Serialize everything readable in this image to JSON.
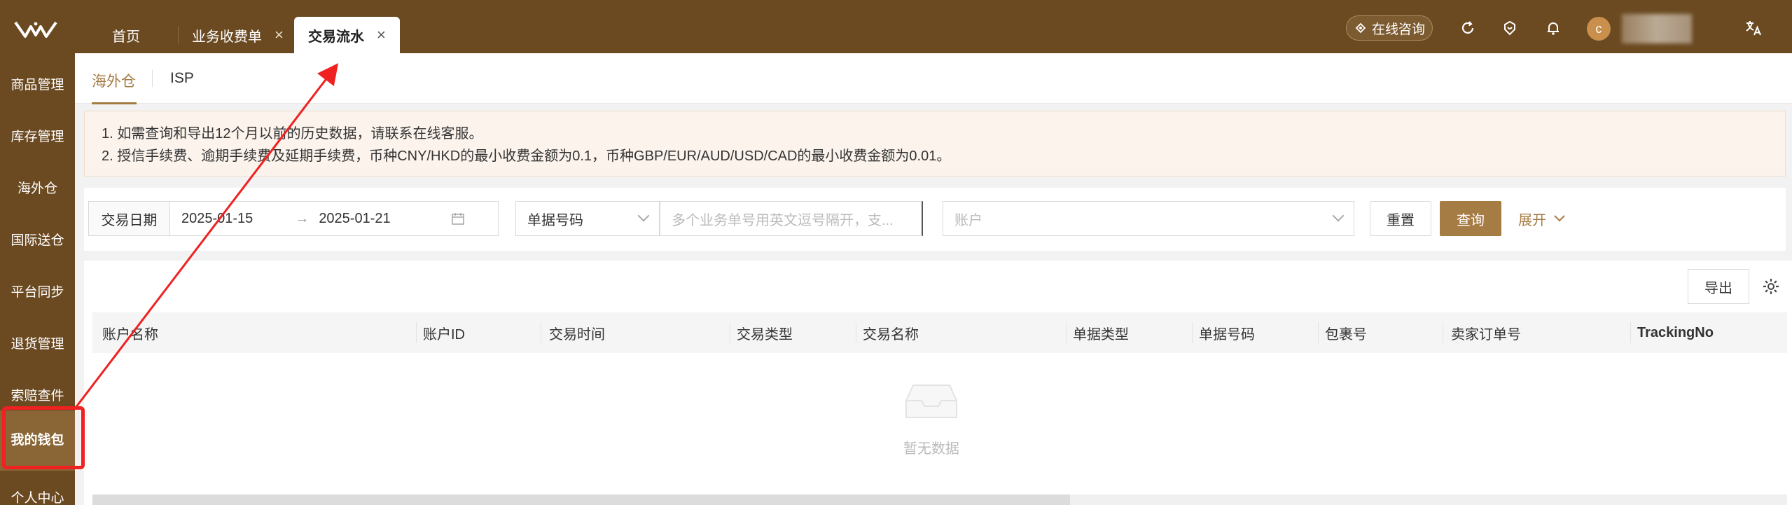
{
  "topbar": {
    "tabs": [
      {
        "label": "首页",
        "closable": false
      },
      {
        "label": "业务收费单",
        "closable": true
      },
      {
        "label": "交易流水",
        "closable": true,
        "active": true
      }
    ],
    "close_glyph": "×",
    "consult_label": "在线咨询",
    "avatar_letter": "c",
    "icons": [
      "refresh-icon",
      "service-icon",
      "bell-icon",
      "translate-icon"
    ]
  },
  "sidebar": {
    "items": [
      {
        "label": "商品管理"
      },
      {
        "label": "库存管理"
      },
      {
        "label": "海外仓"
      },
      {
        "label": "国际送仓"
      },
      {
        "label": "平台同步"
      },
      {
        "label": "退货管理"
      },
      {
        "label": "索赔查件"
      },
      {
        "label": "我的钱包",
        "active": true
      },
      {
        "label": "个人中心"
      }
    ]
  },
  "subtabs": [
    {
      "label": "海外仓",
      "active": true
    },
    {
      "label": "ISP"
    }
  ],
  "notice": {
    "lines": [
      "1. 如需查询和导出12个月以前的历史数据，请联系在线客服。",
      "2. 授信手续费、逾期手续费及延期手续费，币种CNY/HKD的最小收费金额为0.1，币种GBP/EUR/AUD/USD/CAD的最小收费金额为0.01。"
    ]
  },
  "filter": {
    "date_label": "交易日期",
    "date_start": "2025-01-15",
    "date_end": "2025-01-21",
    "range_arrow": "→",
    "doc_type_value": "单据号码",
    "doc_input_placeholder": "多个业务单号用英文逗号隔开，支...",
    "account_placeholder": "账户",
    "reset_label": "重置",
    "query_label": "查询",
    "expand_label": "展开"
  },
  "table": {
    "export_label": "导出",
    "columns": [
      "账户名称",
      "账户ID",
      "交易时间",
      "交易类型",
      "交易名称",
      "单据类型",
      "单据号码",
      "包裹号",
      "卖家订单号",
      "TrackingNo"
    ],
    "rows": [],
    "empty_text": "暂无数据"
  },
  "colors": {
    "brand": "#6b4a22",
    "accent": "#a67c45",
    "annotation": "#ef2121"
  }
}
